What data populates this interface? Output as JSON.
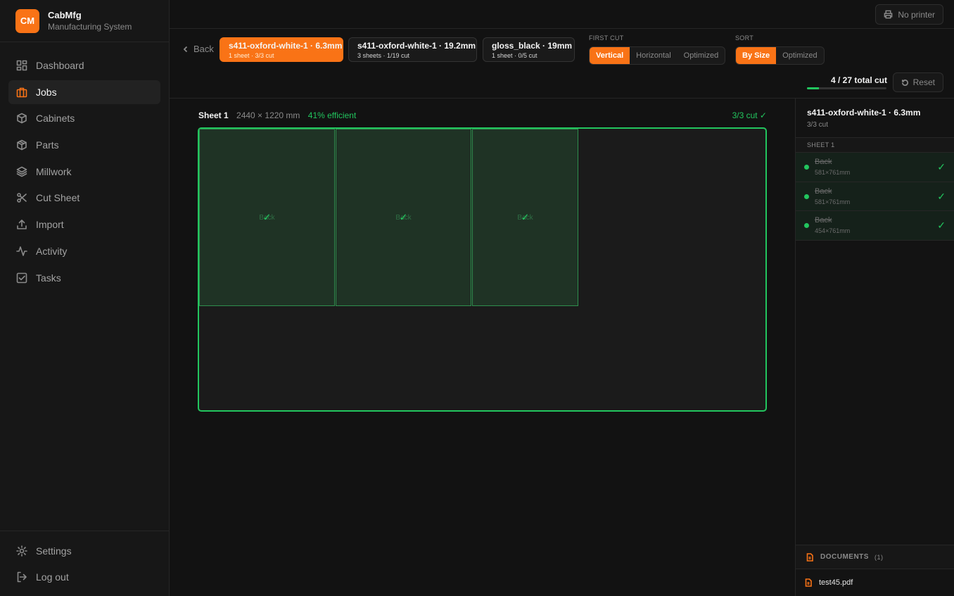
{
  "brand": {
    "logo": "CM",
    "name": "CabMfg",
    "subtitle": "Manufacturing System"
  },
  "nav": {
    "items": [
      {
        "label": "Dashboard",
        "icon": "dashboard-icon"
      },
      {
        "label": "Jobs",
        "icon": "briefcase-icon",
        "active": true
      },
      {
        "label": "Cabinets",
        "icon": "cube-icon"
      },
      {
        "label": "Parts",
        "icon": "package-icon"
      },
      {
        "label": "Millwork",
        "icon": "layers-icon"
      },
      {
        "label": "Cut Sheet",
        "icon": "scissors-icon"
      },
      {
        "label": "Import",
        "icon": "upload-icon"
      },
      {
        "label": "Activity",
        "icon": "activity-icon"
      },
      {
        "label": "Tasks",
        "icon": "checkbox-icon"
      }
    ],
    "bottom": [
      {
        "label": "Settings",
        "icon": "gear-icon"
      },
      {
        "label": "Log out",
        "icon": "logout-icon"
      }
    ]
  },
  "topbar": {
    "printer_label": "No printer"
  },
  "toolbar": {
    "back_label": "Back",
    "materials": [
      {
        "title": "s411-oxford-white-1 · 6.3mm",
        "sub": "1 sheet · 3/3 cut",
        "active": true
      },
      {
        "title": "s411-oxford-white-1 · 19.2mm",
        "sub": "3 sheets · 1/19 cut"
      },
      {
        "title": "gloss_black · 19mm",
        "sub": "1 sheet · 0/5 cut"
      }
    ],
    "first_cut": {
      "label": "FIRST CUT",
      "options": [
        "Vertical",
        "Horizontal",
        "Optimized"
      ],
      "selected": "Vertical"
    },
    "sort": {
      "label": "SORT",
      "options": [
        "By Size",
        "Optimized"
      ],
      "selected": "By Size"
    },
    "total": "4 / 27 total cut",
    "progress_fraction": 0.148,
    "reset_label": "Reset"
  },
  "sheet": {
    "title": "Sheet 1",
    "dimensions": "2440 × 1220 mm",
    "efficiency": "41% efficient",
    "cut_status": "3/3 cut ✓",
    "parts": [
      {
        "label": "Back",
        "check": "✓"
      },
      {
        "label": "Back",
        "check": "✓"
      },
      {
        "label": "Back",
        "check": "✓"
      }
    ]
  },
  "panel": {
    "title": "s411-oxford-white-1 · 6.3mm",
    "subtitle": "3/3 cut",
    "sheet_label": "SHEET 1",
    "items": [
      {
        "name": "Back",
        "size": "581×761mm",
        "check": "✓"
      },
      {
        "name": "Back",
        "size": "581×761mm",
        "check": "✓"
      },
      {
        "name": "Back",
        "size": "454×761mm",
        "check": "✓"
      }
    ],
    "documents_label": "DOCUMENTS",
    "documents_count": "(1)",
    "documents": [
      "test45.pdf"
    ]
  },
  "colors": {
    "accent": "#f97316",
    "success": "#22c55e",
    "background": "#121212"
  }
}
